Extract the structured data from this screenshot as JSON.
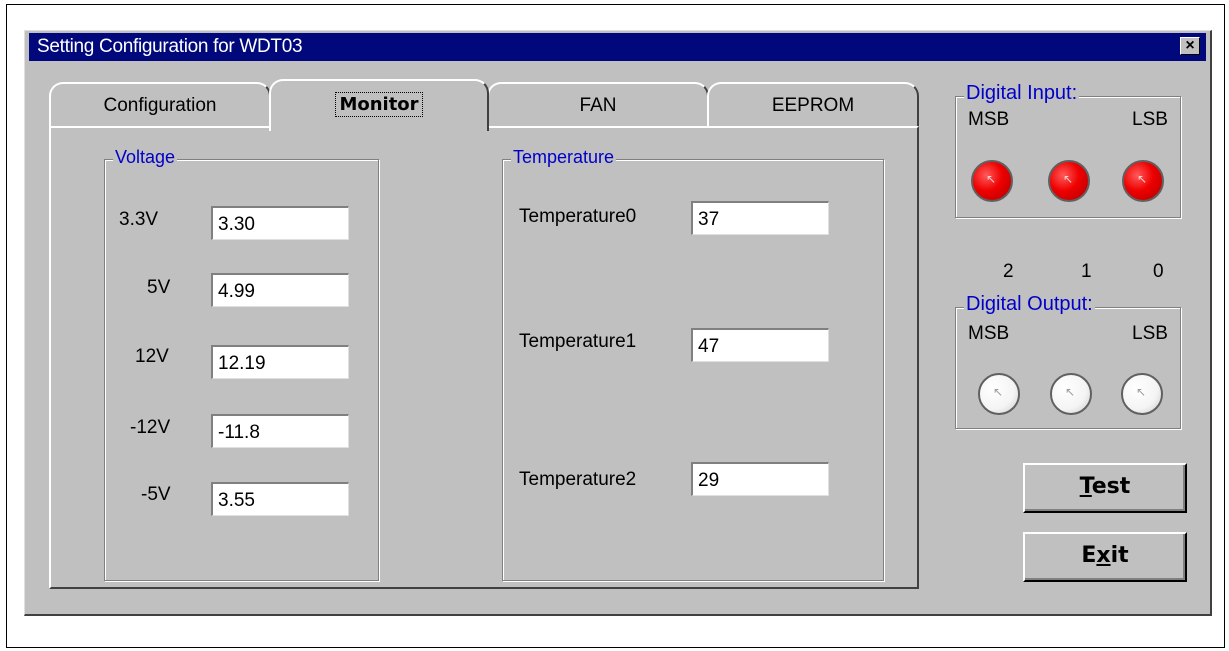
{
  "window": {
    "title": "Setting Configuration for WDT03",
    "close_label": "×"
  },
  "tabs": [
    {
      "label": "Configuration"
    },
    {
      "label": "Monitor",
      "active": true
    },
    {
      "label": "FAN"
    },
    {
      "label": "EEPROM"
    }
  ],
  "voltage": {
    "title": "Voltage",
    "rows": [
      {
        "label": "3.3V",
        "value": "3.30"
      },
      {
        "label": "5V",
        "value": "4.99"
      },
      {
        "label": "12V",
        "value": "12.19"
      },
      {
        "label": "-12V",
        "value": "-11.8"
      },
      {
        "label": "-5V",
        "value": "3.55"
      }
    ]
  },
  "temperature": {
    "title": "Temperature",
    "rows": [
      {
        "label": "Temperature0",
        "value": "37"
      },
      {
        "label": "Temperature1",
        "value": "47"
      },
      {
        "label": "Temperature2",
        "value": "29"
      }
    ]
  },
  "digital_input": {
    "title": "Digital Input:",
    "msb_label": "MSB",
    "lsb_label": "LSB",
    "leds": [
      "red",
      "red",
      "red"
    ],
    "led_color": "#ee0000"
  },
  "bit_labels": [
    "2",
    "1",
    "0"
  ],
  "digital_output": {
    "title": "Digital Output:",
    "msb_label": "MSB",
    "lsb_label": "LSB",
    "leds": [
      "off",
      "off",
      "off"
    ],
    "led_color": "#ffffff"
  },
  "buttons": {
    "test": {
      "prefix": "",
      "mnemonic": "T",
      "suffix": "est"
    },
    "exit": {
      "prefix": "E",
      "mnemonic": "x",
      "suffix": "it"
    }
  },
  "colors": {
    "titlebar": "#00087b",
    "dialog_bg": "#c0c0c0",
    "group_title": "#0000c8"
  }
}
